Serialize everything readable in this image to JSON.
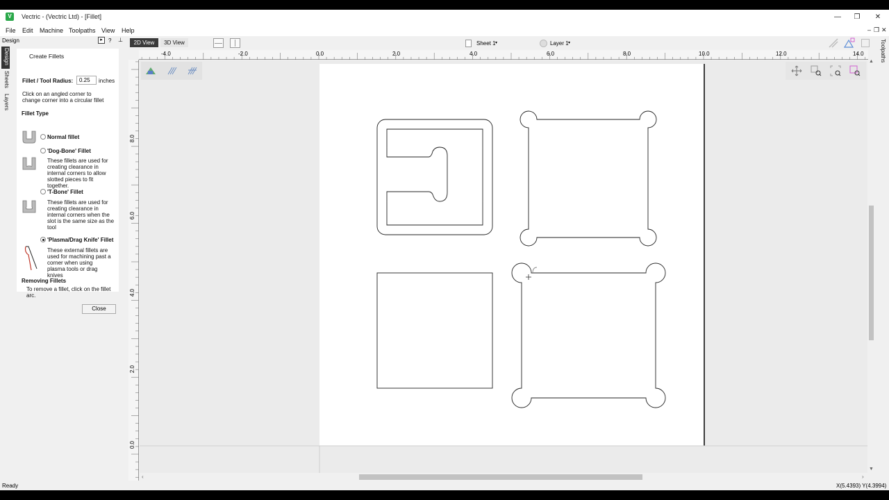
{
  "window": {
    "title": "Vectric - (Vectric Ltd) - [Fillet]",
    "app_icon": "vectric-logo-icon",
    "minimize": "—",
    "restore": "❐",
    "close": "✕"
  },
  "menu": [
    "File",
    "Edit",
    "Machine",
    "Toolpaths",
    "View",
    "Help"
  ],
  "mdi_controls": {
    "minimize": "–",
    "restore": "❐",
    "close": "✕"
  },
  "side_tabs": [
    "Design",
    "Sheets",
    "Layers"
  ],
  "right_tab": "Toolpaths",
  "panel_header": {
    "title": "Design",
    "icons": [
      "dock-icon",
      "help-icon",
      "pin-icon"
    ],
    "help": "?"
  },
  "panel": {
    "heading": "Create Fillets",
    "radius_label": "Fillet / Tool Radius:",
    "radius_value": "0.25",
    "radius_unit": "inches",
    "instructions": "Click on an angled corner to change corner into a circular fillet",
    "fillet_type_heading": "Fillet Type",
    "options": [
      {
        "label": "Normal fillet",
        "description": "",
        "selected": false
      },
      {
        "label": "'Dog-Bone' Fillet",
        "description": "These fillets are used for creating clearance in internal corners to allow slotted pieces to fit together.",
        "selected": false
      },
      {
        "label": "'T-Bone' Fillet",
        "description": "These fillets are used for creating clearance in internal corners when the slot is the same size as the tool",
        "selected": false
      },
      {
        "label": "'Plasma/Drag Knife' Fillet",
        "description": "These external fillets are used for machining past a corner when using plasma tools or drag knives",
        "selected": true
      }
    ],
    "removing_heading": "Removing Fillets",
    "removing_text": "To remove a fillet, click on the fillet arc.",
    "close_label": "Close"
  },
  "view_toolbar": {
    "tab_2d": "2D View",
    "tab_3d": "3D View",
    "sheet": "Sheet 1",
    "layer": "Layer 1",
    "caret": "▾"
  },
  "ruler": {
    "h_labels": [
      "-4.0",
      "-2.0",
      "0.0",
      "2.0",
      "4.0",
      "6.0",
      "8.0",
      "10.0",
      "12.0",
      "14.0"
    ],
    "v_labels": [
      "8.0",
      "6.0",
      "4.0",
      "2.0",
      "0.0"
    ]
  },
  "status": {
    "left": "Ready",
    "coords": "X(5.4393) Y(4.3994)"
  },
  "colors": {
    "accent": "#2aa84a",
    "active_tab": "#3a3a3a",
    "canvas": "#ebebeb",
    "sheet": "#ffffff"
  }
}
